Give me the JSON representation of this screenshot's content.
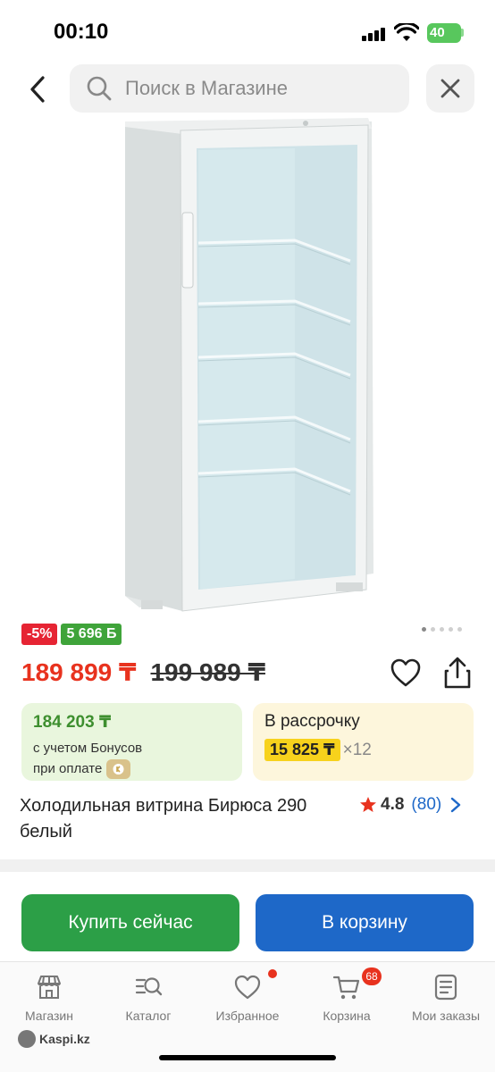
{
  "status_bar": {
    "time": "00:10",
    "battery": "40"
  },
  "header": {
    "search_placeholder": "Поиск в Магазине",
    "back_icon": "chevron-left-icon",
    "search_icon": "search-icon",
    "close_icon": "close-icon"
  },
  "gallery": {
    "image_count": 5,
    "active_index": 0
  },
  "badges": {
    "discount": "-5%",
    "bonus": "5 696 Б"
  },
  "price": {
    "current": "189 899 ₸",
    "old": "199 989 ₸"
  },
  "bonus_card": {
    "amount": "184 203 ₸",
    "line1": "с учетом Бонусов",
    "line2": "при оплате"
  },
  "installment_card": {
    "title": "В рассрочку",
    "amount": "15 825 ₸",
    "times": "×12"
  },
  "product": {
    "title": "Холодильная витрина Бирюса 290 белый",
    "rating": "4.8",
    "reviews": "(80)"
  },
  "actions": {
    "buy_now": "Купить сейчас",
    "add_to_cart": "В корзину"
  },
  "bottom_nav": {
    "items": [
      {
        "label": "Магазин",
        "icon": "store-icon"
      },
      {
        "label": "Каталог",
        "icon": "catalog-search-icon"
      },
      {
        "label": "Избранное",
        "icon": "heart-icon"
      },
      {
        "label": "Корзина",
        "icon": "cart-icon"
      },
      {
        "label": "Мои заказы",
        "icon": "orders-icon"
      }
    ],
    "cart_badge": "68"
  },
  "footer": {
    "logo_text": "Kaspi.kz"
  },
  "colors": {
    "accent_red": "#e8321e",
    "buy_green": "#2c9f47",
    "cart_blue": "#1e68c8"
  }
}
